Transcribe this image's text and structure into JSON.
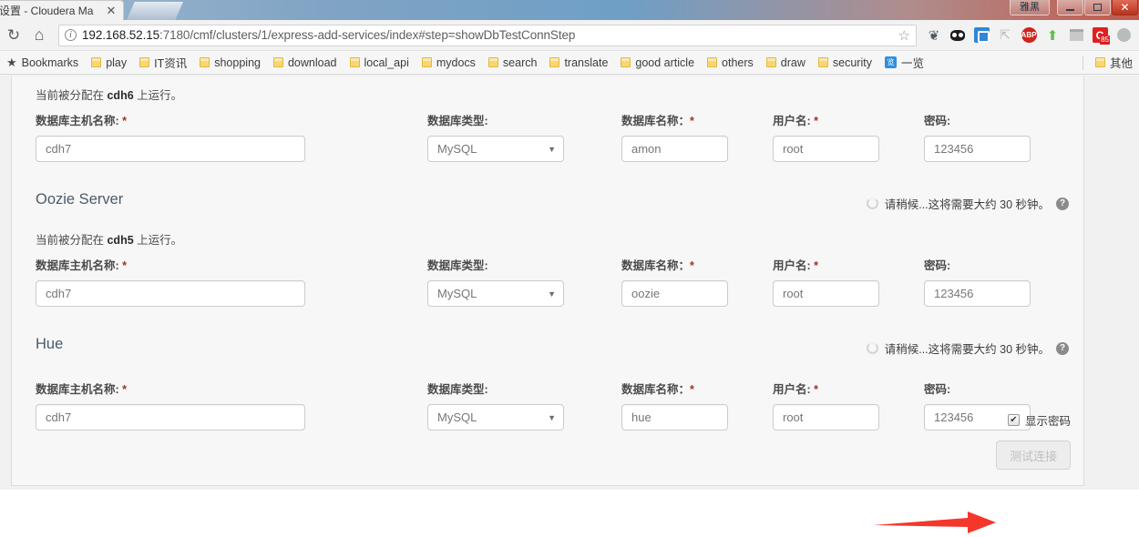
{
  "browser": {
    "tab": {
      "title": "设置 - Cloudera Ma",
      "close_label": "✕"
    },
    "window_controls": {
      "minimize": "",
      "maximize": "",
      "close": "✕",
      "ime_label": "雅黑"
    },
    "nav": {
      "reload_icon": "↻",
      "home_icon": "⌂"
    },
    "omnibox": {
      "info_icon": "i",
      "url_host": "192.168.52.15",
      "url_rest": ":7180/cmf/clusters/1/express-add-services/index#step=showDbTestConnStep",
      "url_full": "192.168.52.15:7180/cmf/clusters/1/express-add-services/index#step=showDbTestConnStep",
      "bookmark_star": "☆"
    },
    "extensions": [
      {
        "name": "evernote-extension-icon",
        "glyph": "❦"
      },
      {
        "name": "dark-capsule-extension-icon",
        "glyph": ""
      },
      {
        "name": "blue-screenshot-extension-icon",
        "glyph": ""
      },
      {
        "name": "cursor-blocked-extension-icon",
        "glyph": "⇱"
      },
      {
        "name": "adblock-plus-extension-icon",
        "glyph": "ABP"
      },
      {
        "name": "green-arrow-extension-icon",
        "glyph": "⬆"
      },
      {
        "name": "gray-panel-extension-icon",
        "glyph": ""
      },
      {
        "name": "c-badge-extension-icon",
        "glyph": "C",
        "badge": "85"
      },
      {
        "name": "gray-ball-extension-icon",
        "glyph": ""
      }
    ],
    "bookmarks": {
      "root_label": "Bookmarks",
      "items": [
        {
          "label": "play",
          "icon": "folder"
        },
        {
          "label": "IT资讯",
          "icon": "folder"
        },
        {
          "label": "shopping",
          "icon": "folder"
        },
        {
          "label": "download",
          "icon": "folder"
        },
        {
          "label": "local_api",
          "icon": "folder"
        },
        {
          "label": "mydocs",
          "icon": "folder"
        },
        {
          "label": "search",
          "icon": "folder"
        },
        {
          "label": "translate",
          "icon": "folder"
        },
        {
          "label": "good article",
          "icon": "folder"
        },
        {
          "label": "others",
          "icon": "folder"
        },
        {
          "label": "draw",
          "icon": "folder"
        },
        {
          "label": "security",
          "icon": "folder"
        },
        {
          "label": "一览",
          "icon": "blue",
          "blue_glyph": "览"
        }
      ],
      "overflow_label": "其他",
      "overflow_icon": "folder"
    }
  },
  "page": {
    "labels": {
      "host": "数据库主机名称:",
      "type": "数据库类型:",
      "dbname": "数据库名称：",
      "username": "用户名:",
      "password": "密码:",
      "required_mark": "*"
    },
    "status": {
      "text": "请稍候...这将需要大约 30 秒钟。",
      "help_glyph": "?"
    },
    "sections": [
      {
        "name": "activity-monitor",
        "heading": "",
        "assigned_prefix": "当前被分配在 ",
        "assigned_host": "cdh6",
        "assigned_suffix": " 上运行。",
        "has_status": false,
        "host": "cdh7",
        "type": "MySQL",
        "dbname": "amon",
        "username": "root",
        "password": "123456"
      },
      {
        "name": "oozie-server",
        "heading": "Oozie Server",
        "assigned_prefix": "当前被分配在 ",
        "assigned_host": "cdh5",
        "assigned_suffix": " 上运行。",
        "has_status": true,
        "host": "cdh7",
        "type": "MySQL",
        "dbname": "oozie",
        "username": "root",
        "password": "123456"
      },
      {
        "name": "hue",
        "heading": "Hue",
        "assigned_prefix": "",
        "assigned_host": "",
        "assigned_suffix": "",
        "has_status": true,
        "host": "cdh7",
        "type": "MySQL",
        "dbname": "hue",
        "username": "root",
        "password": "123456"
      }
    ],
    "show_password": {
      "label": "显示密码",
      "checked": true,
      "check_glyph": "✔"
    },
    "test_button": {
      "label": "测试连接",
      "enabled": false
    },
    "annotation_arrow": {
      "color": "#f4372a"
    }
  }
}
